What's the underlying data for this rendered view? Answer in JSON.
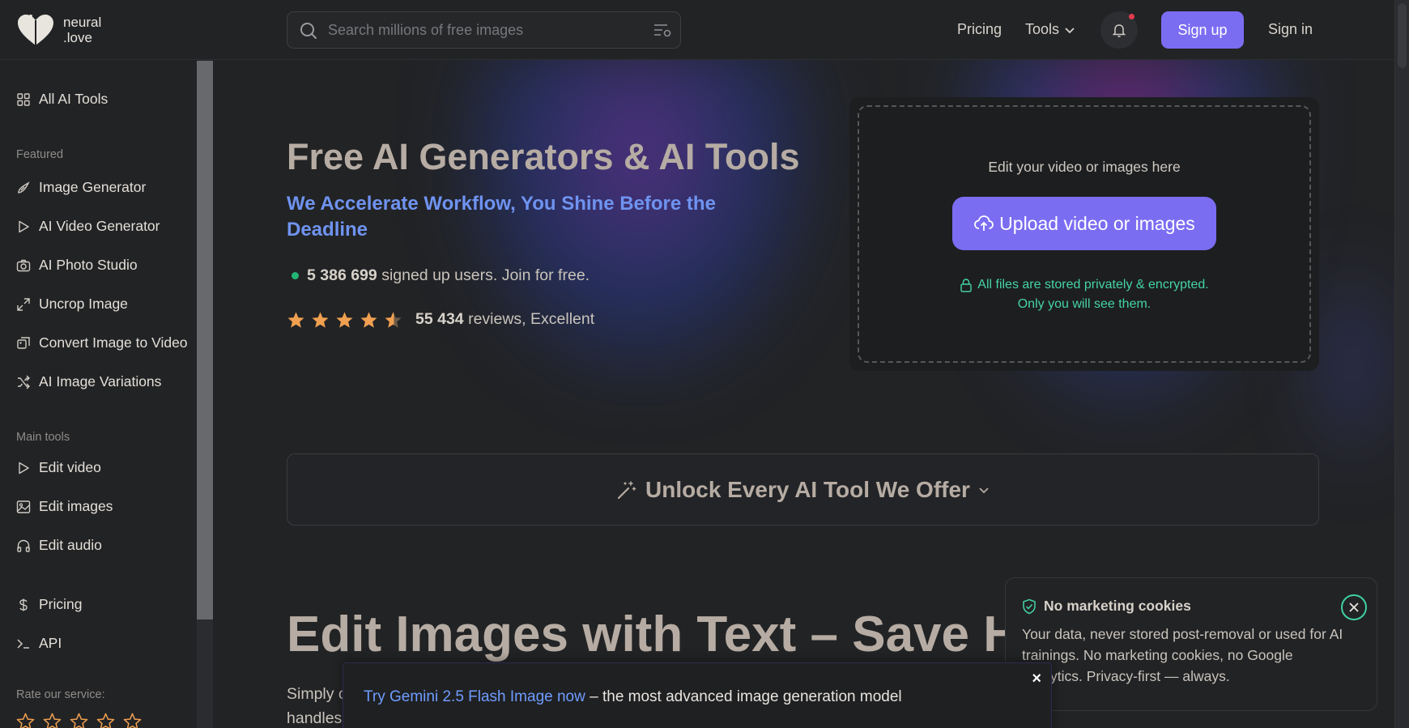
{
  "brand": {
    "line1": "neural",
    "line2": ".love"
  },
  "search": {
    "placeholder": "Search millions of free images"
  },
  "header": {
    "pricing": "Pricing",
    "tools": "Tools",
    "signup": "Sign up",
    "signin": "Sign in"
  },
  "sidebar": {
    "all_tools": "All AI Tools",
    "featured_title": "Featured",
    "featured": [
      {
        "label": "Image Generator",
        "icon": "brush-icon"
      },
      {
        "label": "AI Video Generator",
        "icon": "play-icon"
      },
      {
        "label": "AI Photo Studio",
        "icon": "camera-icon"
      },
      {
        "label": "Uncrop Image",
        "icon": "expand-icon"
      },
      {
        "label": "Convert Image to Video",
        "icon": "image-video-icon"
      },
      {
        "label": "AI Image Variations",
        "icon": "shuffle-icon"
      }
    ],
    "main_title": "Main tools",
    "main": [
      {
        "label": "Edit video",
        "icon": "play-icon"
      },
      {
        "label": "Edit images",
        "icon": "image-icon"
      },
      {
        "label": "Edit audio",
        "icon": "headphones-icon"
      }
    ],
    "pricing": "Pricing",
    "api": "API",
    "rate_title": "Rate our service:",
    "rate_stars": 5
  },
  "hero": {
    "title": "Free AI Generators & AI Tools",
    "subtitle": "We Accelerate Workflow, You Shine Before the Deadline",
    "users_count": "5 386 699",
    "users_text": "signed up users. Join for free.",
    "rating_stars": 4.5,
    "reviews_count": "55 434",
    "reviews_text": "reviews, Excellent"
  },
  "upload": {
    "hint": "Edit your video or images here",
    "button": "Upload video or images",
    "privacy_line1": "All files are stored privately & encrypted.",
    "privacy_line2": "Only you will see them."
  },
  "unlock": {
    "label": "Unlock Every AI Tool We Offer"
  },
  "section": {
    "title": "Edit Images with Text – Save Ho",
    "para_line1": "Simply c",
    "para_line2": "handles"
  },
  "banner": {
    "link": "Try Gemini 2.5 Flash Image now",
    "rest": " – the most advanced image generation model",
    "close": "×"
  },
  "cookie": {
    "title": "No marketing cookies",
    "body": "Your data, never stored post-removal or used for AI trainings. No marketing cookies, no Google Analytics. Privacy-first — always."
  },
  "colors": {
    "accent": "#7b6df2",
    "link": "#6f9cff",
    "subtitle": "#6f93f0",
    "success": "#45d4a4",
    "star": "#f0a050"
  }
}
